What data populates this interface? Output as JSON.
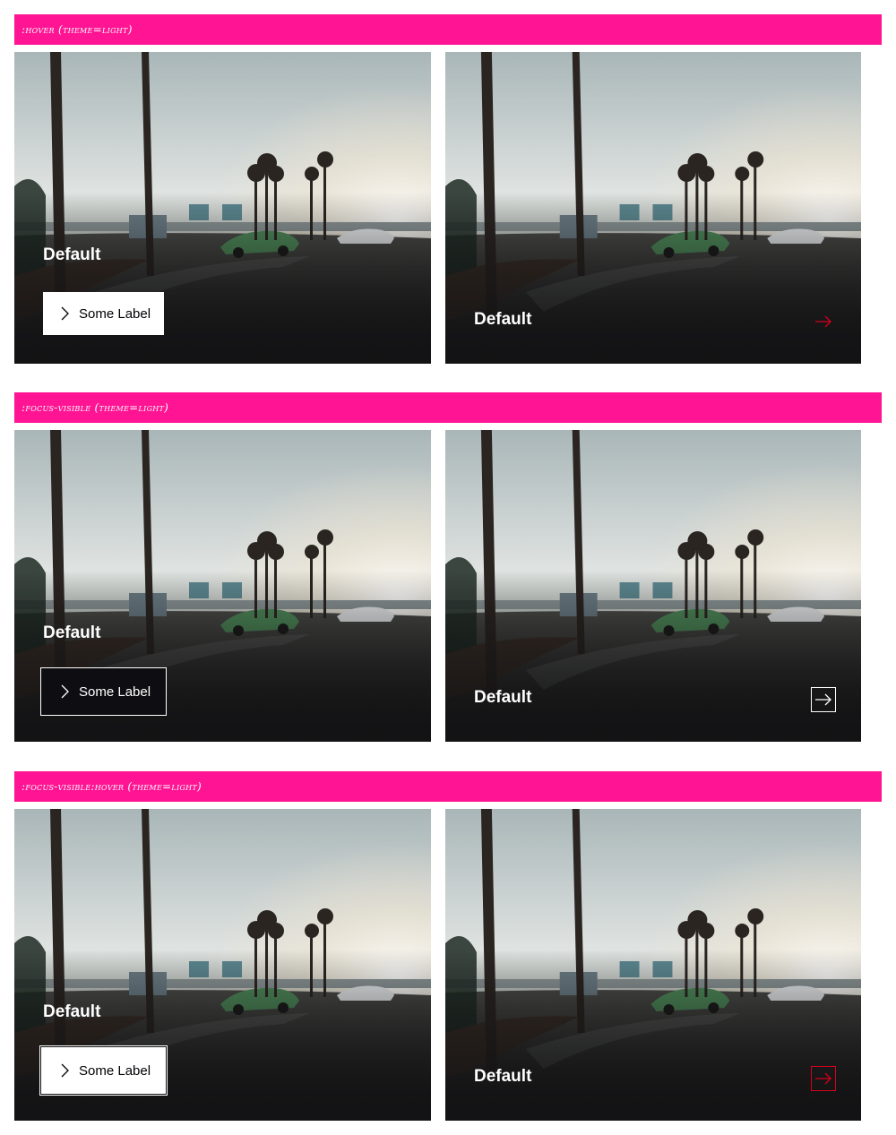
{
  "sections": [
    {
      "header": ":hover (theme=light)",
      "left": {
        "title": "Default",
        "button_label": "Some Label"
      },
      "right": {
        "title": "Default"
      }
    },
    {
      "header": ":focus-visible (theme=light)",
      "left": {
        "title": "Default",
        "button_label": "Some Label"
      },
      "right": {
        "title": "Default"
      }
    },
    {
      "header": ":focus-visible:hover (theme=light)",
      "left": {
        "title": "Default",
        "button_label": "Some Label"
      },
      "right": {
        "title": "Default"
      }
    }
  ],
  "colors": {
    "header_bg": "#ff1493",
    "accent_red": "#d5001c",
    "dark_button": "#0e0e12"
  },
  "icons": {
    "button": "chevron-right-icon",
    "card_link": "arrow-right-icon"
  }
}
